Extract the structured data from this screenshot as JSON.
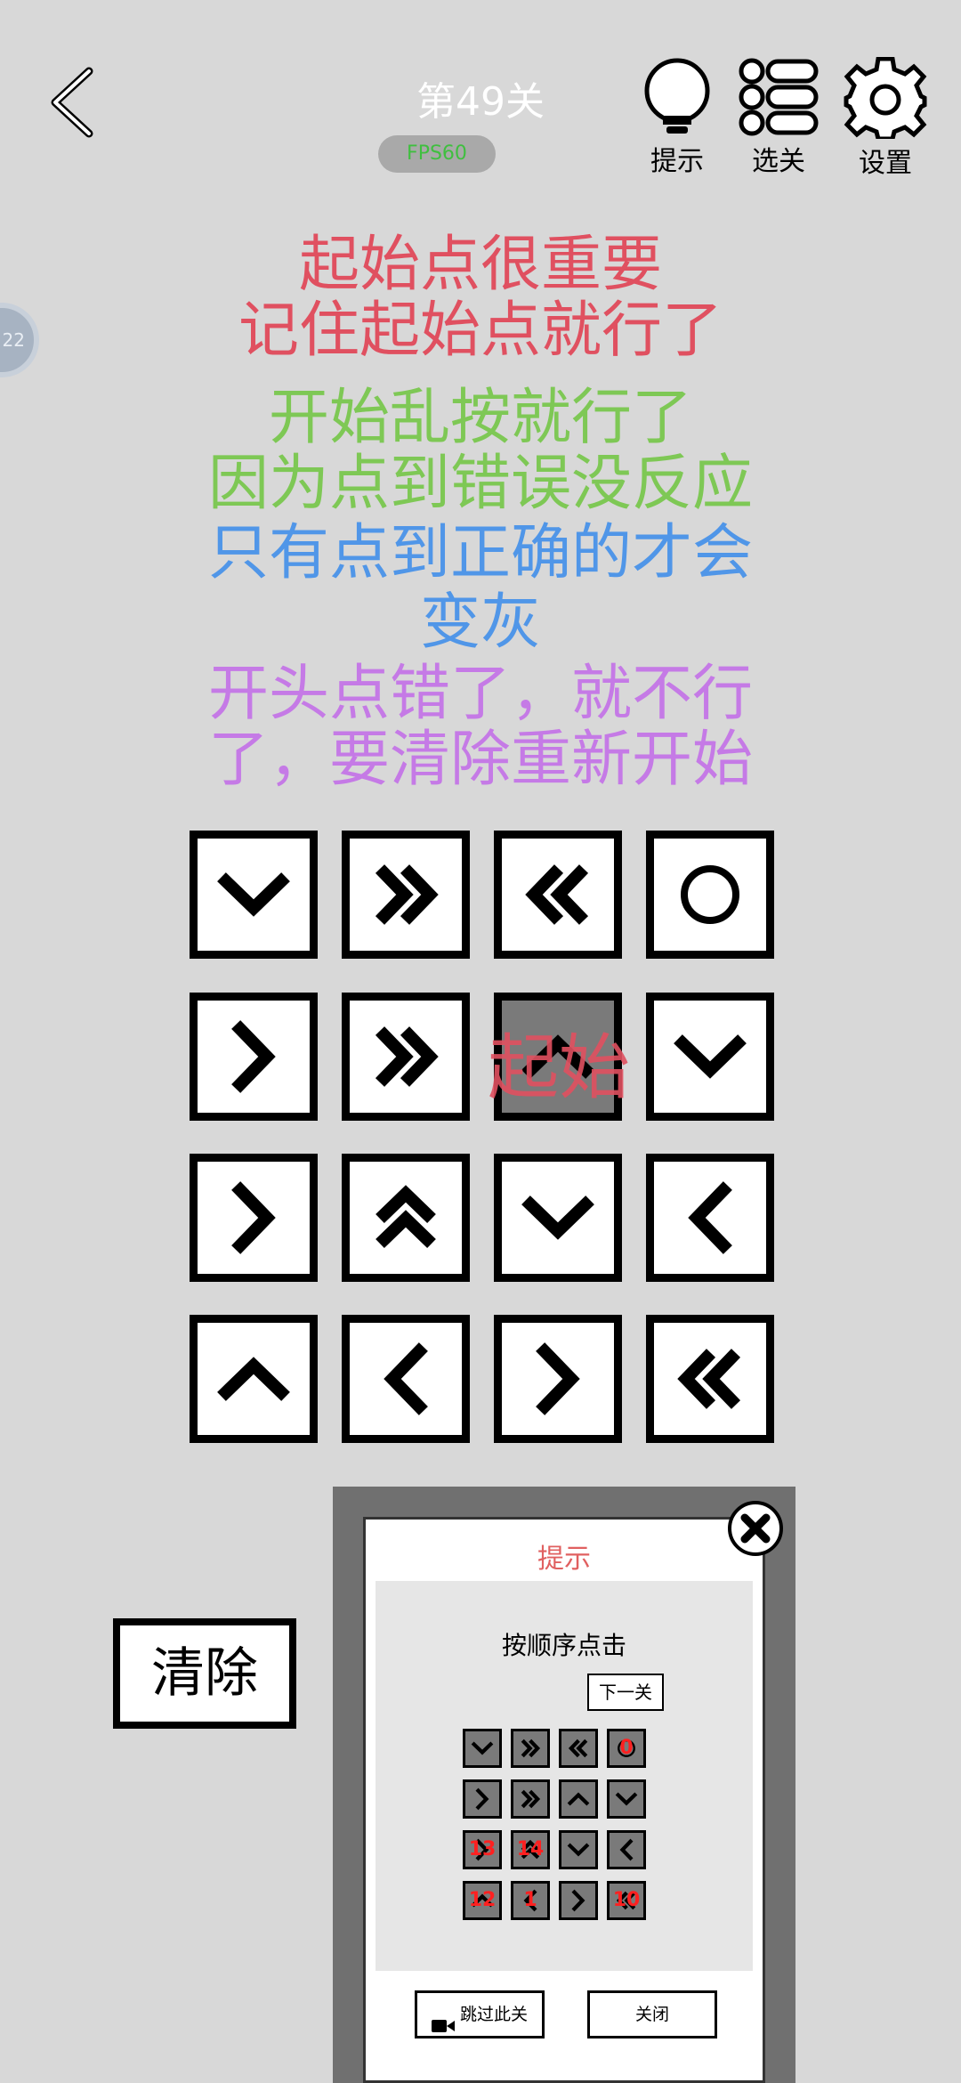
{
  "header": {
    "level_title": "第49关",
    "fps_badge": "FPS60",
    "hint_label": "提示",
    "levels_label": "选关",
    "settings_label": "设置"
  },
  "side_bubble": "22",
  "tips": [
    {
      "text": "起始点很重要",
      "color": "#e05060"
    },
    {
      "text": "记住起始点就行了",
      "color": "#e05060"
    },
    {
      "text": "开始乱按就行了",
      "color": "#7ec855"
    },
    {
      "text": "因为点到错误没反应",
      "color": "#7ec855"
    },
    {
      "text": "只有点到正确的才会",
      "color": "#5096e8"
    },
    {
      "text": "变灰",
      "color": "#5096e8"
    },
    {
      "text": "开头点错了，就不行",
      "color": "#c57ae6"
    },
    {
      "text": "了，要清除重新开始",
      "color": "#c57ae6"
    }
  ],
  "grid": {
    "rows": [
      [
        "chevron-down",
        "double-chevron-right",
        "double-chevron-left",
        "circle"
      ],
      [
        "chevron-right",
        "double-chevron-right",
        "chevron-up-active",
        "chevron-down"
      ],
      [
        "chevron-right",
        "double-chevron-up",
        "chevron-down",
        "chevron-left"
      ],
      [
        "chevron-up",
        "chevron-left",
        "chevron-right",
        "double-chevron-left"
      ]
    ],
    "active_cell": [
      1,
      2
    ],
    "start_label": "起始"
  },
  "clear_button": "清除",
  "hint_panel": {
    "title": "提示",
    "instruction": "按顺序点击",
    "next_button": "下一关",
    "numbers": [
      [
        "",
        "",
        "",
        "0"
      ],
      [
        "",
        "",
        "",
        ""
      ],
      [
        "13",
        "14",
        "",
        ""
      ],
      [
        "12",
        "1",
        "",
        "10"
      ]
    ],
    "skip_button": "跳过此关",
    "close_button": "关闭"
  },
  "colors": {
    "background": "#d8d8d8",
    "active_cell": "#7a7a7a",
    "start_label": "#e05060"
  }
}
